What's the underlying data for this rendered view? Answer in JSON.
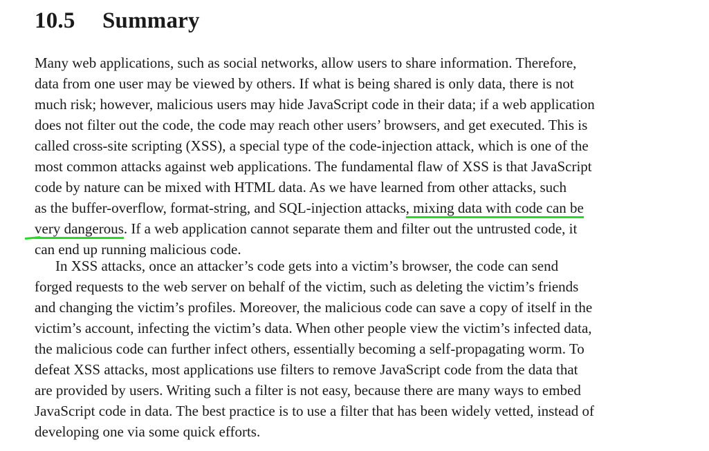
{
  "section": {
    "number": "10.5",
    "title": "Summary"
  },
  "paragraph1": {
    "lines": [
      "Many web applications, such as social networks, allow users to share information. Therefore,",
      "data from one user may be viewed by others. If what is being shared is only data, there is not",
      "much risk; however, malicious users may hide JavaScript code in their data; if a web application",
      "does not filter out the code, the code may reach other users’ browsers, and get executed. This is",
      "called cross-site scripting (XSS), a special type of the code-injection attack, which is one of the",
      "most common attacks against web applications. The fundamental flaw of XSS is that JavaScript",
      "code by nature can be mixed with HTML data. As we have learned from other attacks, such"
    ],
    "line8_start": "as the buffer-overflow, format-string, and SQL-injection attacks",
    "line8_highlight": ", mixing data with code can be",
    "line9_highlight": "very dangerous",
    "line9_end": ". If a web application cannot separate them and filter out the untrusted code, it",
    "line10": "can end up running malicious code."
  },
  "paragraph2": {
    "lines": [
      "In XSS attacks, once an attacker’s code gets into a victim’s browser, the code can send",
      "forged requests to the web server on behalf of the victim, such as deleting the victim’s friends",
      "and changing the victim’s profiles. Moreover, the malicious code can save a copy of itself in the",
      "victim’s account, infecting the victim’s data. When other people view the victim’s infected data,",
      "the malicious code can further infect others, essentially becoming a self-propagating worm. To",
      "defeat XSS attacks, most applications use filters to remove JavaScript code from the data that",
      "are provided by users. Writing such a filter is not easy, because there are many ways to embed",
      "JavaScript code in data. The best practice is to use a filter that has been widely vetted, instead of",
      "developing one via some quick efforts."
    ]
  },
  "colors": {
    "text": "#1a1a1a",
    "highlight": "#22dd22",
    "background": "#ffffff"
  }
}
